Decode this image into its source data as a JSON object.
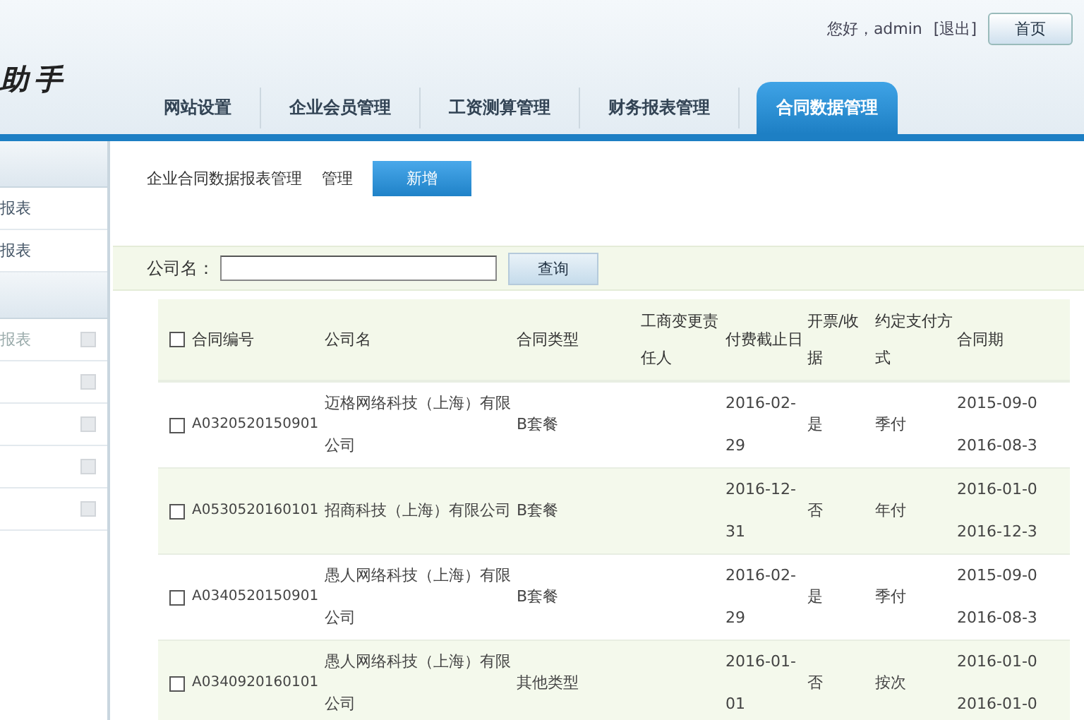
{
  "header": {
    "logo": "助手",
    "greeting": "您好，admin",
    "logout": "[退出]",
    "home_button": "首页"
  },
  "nav_tabs": [
    {
      "label": "网站设置",
      "selected": false
    },
    {
      "label": "企业会员管理",
      "selected": false
    },
    {
      "label": "工资测算管理",
      "selected": false
    },
    {
      "label": "财务报表管理",
      "selected": false
    },
    {
      "label": "合同数据管理",
      "selected": true
    }
  ],
  "sidebar": {
    "groups": [
      {
        "items": [
          {
            "kind": "plain",
            "label": "报表"
          },
          {
            "kind": "plain",
            "label": "报表"
          }
        ]
      },
      {
        "items": [
          {
            "kind": "tool",
            "label": "报表"
          },
          {
            "kind": "tool"
          },
          {
            "kind": "tool"
          },
          {
            "kind": "tool"
          },
          {
            "kind": "tool"
          }
        ]
      }
    ]
  },
  "content": {
    "title": "企业合同数据报表管理",
    "action_label": "管理",
    "add_button": "新增",
    "search": {
      "label": "公司名：",
      "button": "查询"
    },
    "table": {
      "select_all": {
        "checked": false
      },
      "columns": [
        "合同编号",
        "公司名",
        "合同类型",
        "工商变更责任人",
        "付费截止日",
        "开票/收据",
        "约定支付方式",
        "合同期"
      ],
      "rows": [
        {
          "checked": false,
          "cells": [
            "A0320520150901",
            "迈格网络科技（上海）有限公司",
            "B套餐",
            "",
            "2016-02-29",
            "是",
            "季付"
          ],
          "period": [
            "2015-09-0",
            "2016-08-3"
          ]
        },
        {
          "checked": false,
          "cells": [
            "A0530520160101",
            "招商科技（上海）有限公司",
            "B套餐",
            "",
            "2016-12-31",
            "否",
            "年付"
          ],
          "period": [
            "2016-01-0",
            "2016-12-3"
          ]
        },
        {
          "checked": false,
          "cells": [
            "A0340520150901",
            "愚人网络科技（上海）有限公司",
            "B套餐",
            "",
            "2016-02-29",
            "是",
            "季付"
          ],
          "period": [
            "2015-09-0",
            "2016-08-3"
          ]
        },
        {
          "checked": false,
          "cells": [
            "A0340920160101",
            "愚人网络科技（上海）有限公司",
            "其他类型",
            "",
            "2016-01-01",
            "否",
            "按次"
          ],
          "period": [
            "2016-01-0",
            "2016-01-0"
          ]
        }
      ]
    }
  }
}
